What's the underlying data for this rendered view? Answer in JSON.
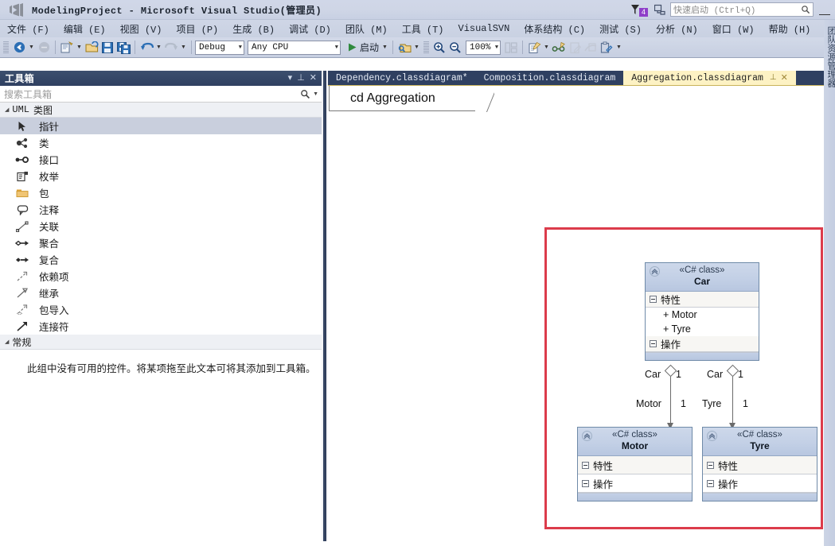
{
  "window": {
    "title": "ModelingProject - Microsoft Visual Studio(管理员)",
    "logo_icon": "visual-studio-logo",
    "minimize_label": "—"
  },
  "titlebar_right": {
    "notification_icon": "notification-flag-icon",
    "notification_count": "4",
    "feedback_icon": "feedback-smiley-icon",
    "quick_launch_placeholder": "快速启动 (Ctrl+Q)",
    "search_icon": "magnifier-icon"
  },
  "menu": {
    "items": [
      {
        "label": "文件 (F)"
      },
      {
        "label": "编辑 (E)"
      },
      {
        "label": "视图 (V)"
      },
      {
        "label": "项目 (P)"
      },
      {
        "label": "生成 (B)"
      },
      {
        "label": "调试 (D)"
      },
      {
        "label": "团队 (M)"
      },
      {
        "label": "工具 (T)"
      },
      {
        "label": "VisualSVN"
      },
      {
        "label": "体系结构 (C)"
      },
      {
        "label": "测试 (S)"
      },
      {
        "label": "分析 (N)"
      },
      {
        "label": "窗口 (W)"
      },
      {
        "label": "帮助 (H)"
      }
    ]
  },
  "toolbar": {
    "navigate_back_icon": "navigate-back-icon",
    "navigate_forward_icon": "navigate-forward-icon",
    "new_project_icon": "new-project-icon",
    "open_file_icon": "open-file-icon",
    "save_icon": "save-icon",
    "save_all_icon": "save-all-icon",
    "undo_icon": "undo-icon",
    "redo_icon": "redo-icon",
    "config_value": "Debug",
    "platform_value": "Any CPU",
    "start_icon": "play-icon",
    "start_label": "启动",
    "find_icon": "find-in-files-icon",
    "zoom_in_icon": "zoom-in-icon",
    "zoom_out_icon": "zoom-out-icon",
    "zoom_value": "100%",
    "layout_icon": "layout-icon",
    "new_diagram_icon": "new-diagram-icon",
    "link_icon": "link-items-icon",
    "edit_doc_icon": "edit-document-icon",
    "merge_icon": "merge-document-icon",
    "paste_doc_icon": "paste-document-icon",
    "overflow_icon": "toolbar-overflow-icon"
  },
  "toolbox": {
    "title": "工具箱",
    "header_icons": {
      "dropdown": "chevron-down-icon",
      "pin": "pin-icon",
      "close": "close-icon"
    },
    "search_placeholder": "搜索工具箱",
    "search_icon": "magnifier-icon",
    "search_dropdown_icon": "chevron-down-icon",
    "groups": [
      {
        "label_mono": "UML",
        "label_cn": "类图",
        "expanded": true,
        "items": [
          {
            "label": "指针",
            "icon": "pointer-icon",
            "selected": true
          },
          {
            "label": "类",
            "icon": "class-icon",
            "selected": false
          },
          {
            "label": "接口",
            "icon": "interface-icon",
            "selected": false
          },
          {
            "label": "枚举",
            "icon": "enumeration-icon",
            "selected": false
          },
          {
            "label": "包",
            "icon": "package-folder-icon",
            "selected": false
          },
          {
            "label": "注释",
            "icon": "comment-icon",
            "selected": false
          },
          {
            "label": "关联",
            "icon": "association-icon",
            "selected": false
          },
          {
            "label": "聚合",
            "icon": "aggregation-icon",
            "selected": false
          },
          {
            "label": "复合",
            "icon": "composition-icon",
            "selected": false
          },
          {
            "label": "依赖项",
            "icon": "dependency-icon",
            "selected": false
          },
          {
            "label": "继承",
            "icon": "inheritance-icon",
            "selected": false
          },
          {
            "label": "包导入",
            "icon": "package-import-icon",
            "selected": false
          },
          {
            "label": "连接符",
            "icon": "connector-icon",
            "selected": false
          }
        ]
      },
      {
        "label_cn": "常规",
        "expanded": true,
        "items": []
      }
    ],
    "empty_group_note": "此组中没有可用的控件。将某项拖至此文本可将其添加到工具箱。"
  },
  "document_tabs": [
    {
      "label": "Dependency.classdiagram*",
      "active": false
    },
    {
      "label": "Composition.classdiagram",
      "active": false
    },
    {
      "label": "Aggregation.classdiagram",
      "active": true,
      "pin_icon": "pin-icon",
      "close_icon": "close-icon"
    }
  ],
  "diagram": {
    "heading": "cd Aggregation",
    "annotation_color": "#dc3c4b",
    "classes": [
      {
        "name": "Car",
        "stereotype": "«C# class»",
        "collapse_icon": "chevron-up-icon",
        "sections": [
          {
            "label": "特性",
            "toggle_icon": "minus-box-icon",
            "members": [
              "+ Motor",
              "+ Tyre"
            ]
          },
          {
            "label": "操作",
            "toggle_icon": "minus-box-icon",
            "members": []
          }
        ]
      },
      {
        "name": "Motor",
        "stereotype": "«C# class»",
        "collapse_icon": "chevron-up-icon",
        "sections": [
          {
            "label": "特性",
            "toggle_icon": "minus-box-icon",
            "members": []
          },
          {
            "label": "操作",
            "toggle_icon": "minus-box-icon",
            "members": []
          }
        ]
      },
      {
        "name": "Tyre",
        "stereotype": "«C# class»",
        "collapse_icon": "chevron-up-icon",
        "sections": [
          {
            "label": "特性",
            "toggle_icon": "minus-box-icon",
            "members": []
          },
          {
            "label": "操作",
            "toggle_icon": "minus-box-icon",
            "members": []
          }
        ]
      }
    ],
    "relationships": [
      {
        "type": "aggregation",
        "source": "Car",
        "target": "Motor",
        "source_role": "Car",
        "source_multiplicity": "1",
        "target_role": "Motor",
        "target_multiplicity": "1"
      },
      {
        "type": "aggregation",
        "source": "Car",
        "target": "Tyre",
        "source_role": "Car",
        "source_multiplicity": "1",
        "target_role": "Tyre",
        "target_multiplicity": "1"
      }
    ]
  },
  "right_strip": {
    "vertical_label": "团队资源管理器"
  }
}
